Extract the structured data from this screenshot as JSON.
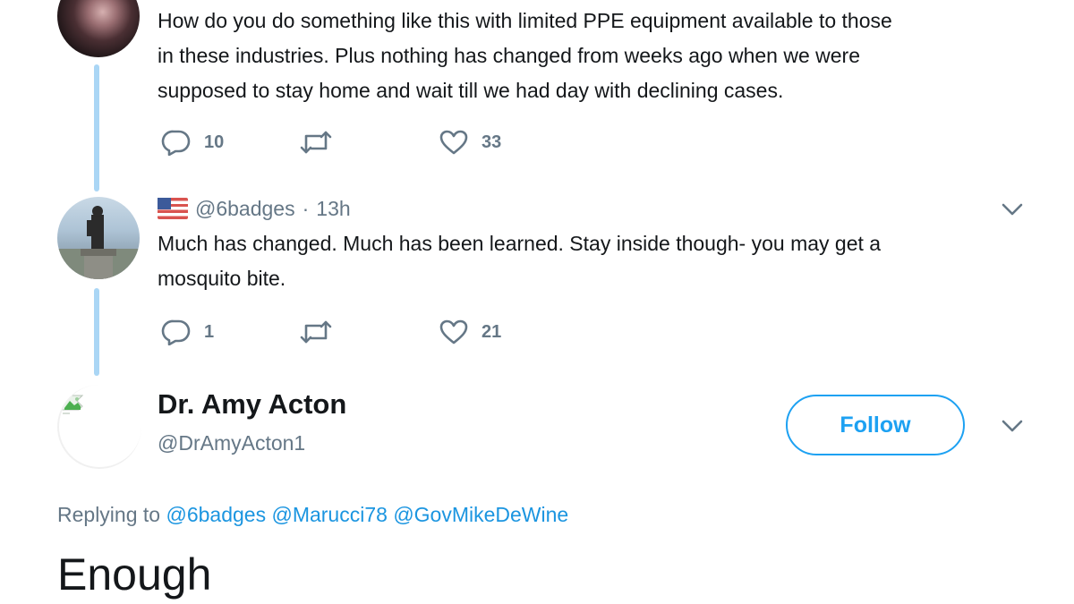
{
  "thread": {
    "previous_reply": {
      "text_lines": [
        "How do you do something like this with limited PPE equipment available to those",
        "in these industries.  Plus nothing has changed from weeks ago when we were",
        "supposed to stay home and wait till we had day with declining cases."
      ],
      "reply_count": "10",
      "like_count": "33"
    },
    "reply": {
      "handle": "@6badges",
      "separator": "·",
      "time": "13h",
      "text_lines": [
        "Much has changed. Much has been learned. Stay inside though- you may get a",
        "mosquito bite."
      ],
      "reply_count": "1",
      "like_count": "21"
    }
  },
  "main_tweet": {
    "author_name": "Dr. Amy Acton",
    "author_handle": "@DrAmyActon1",
    "follow_label": "Follow",
    "replying_to_label": "Replying to",
    "mentions": [
      "@6badges",
      "@Marucci78",
      "@GovMikeDeWine"
    ],
    "text": "Enough"
  },
  "colors": {
    "accent": "#1da1f2",
    "mention": "#1b95e0",
    "thread_line": "#aad6f5",
    "muted": "#657786",
    "text": "#14171a"
  },
  "icons": {
    "reply": "speech-bubble-icon",
    "retweet": "retweet-arrows-icon",
    "like": "heart-icon",
    "more": "chevron-down-icon",
    "flag": "us-flag-icon",
    "broken_image": "broken-image-icon"
  }
}
